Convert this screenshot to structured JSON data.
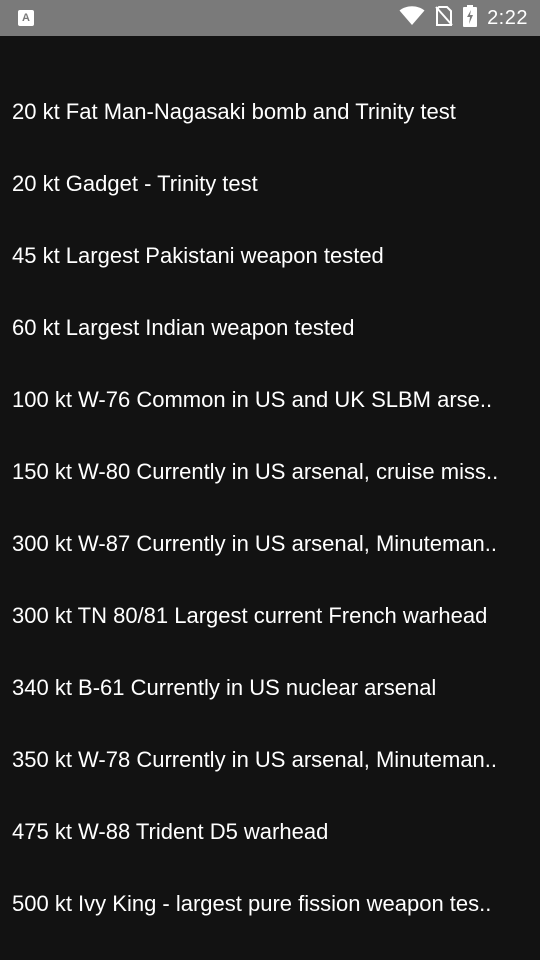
{
  "status_bar": {
    "left_icon": "app-a-icon",
    "left_icon_letter": "A",
    "right_icons": [
      "wifi-icon",
      "no-sim-icon",
      "battery-charging-icon"
    ],
    "time": "2:22",
    "background_color": "#7a7a7a"
  },
  "list": {
    "background_color": "#121212",
    "text_color": "#ffffff",
    "items": [
      {
        "label": "20 kt Fat Man-Nagasaki bomb and Trinity test"
      },
      {
        "label": "20 kt Gadget - Trinity test"
      },
      {
        "label": "45 kt Largest Pakistani weapon tested"
      },
      {
        "label": "60 kt Largest Indian weapon tested"
      },
      {
        "label": "100 kt W-76 Common in US and UK SLBM arse.."
      },
      {
        "label": "150 kt W-80 Currently in US arsenal, cruise miss.."
      },
      {
        "label": "300 kt W-87 Currently in US arsenal, Minuteman.."
      },
      {
        "label": "300 kt TN 80/81 Largest current French warhead"
      },
      {
        "label": "340 kt B-61 Currently in US nuclear arsenal"
      },
      {
        "label": "350 kt W-78 Currently in US arsenal, Minuteman.."
      },
      {
        "label": "475 kt W-88 Trident D5 warhead"
      },
      {
        "label": "500 kt Ivy King - largest pure fission weapon tes.."
      }
    ]
  }
}
